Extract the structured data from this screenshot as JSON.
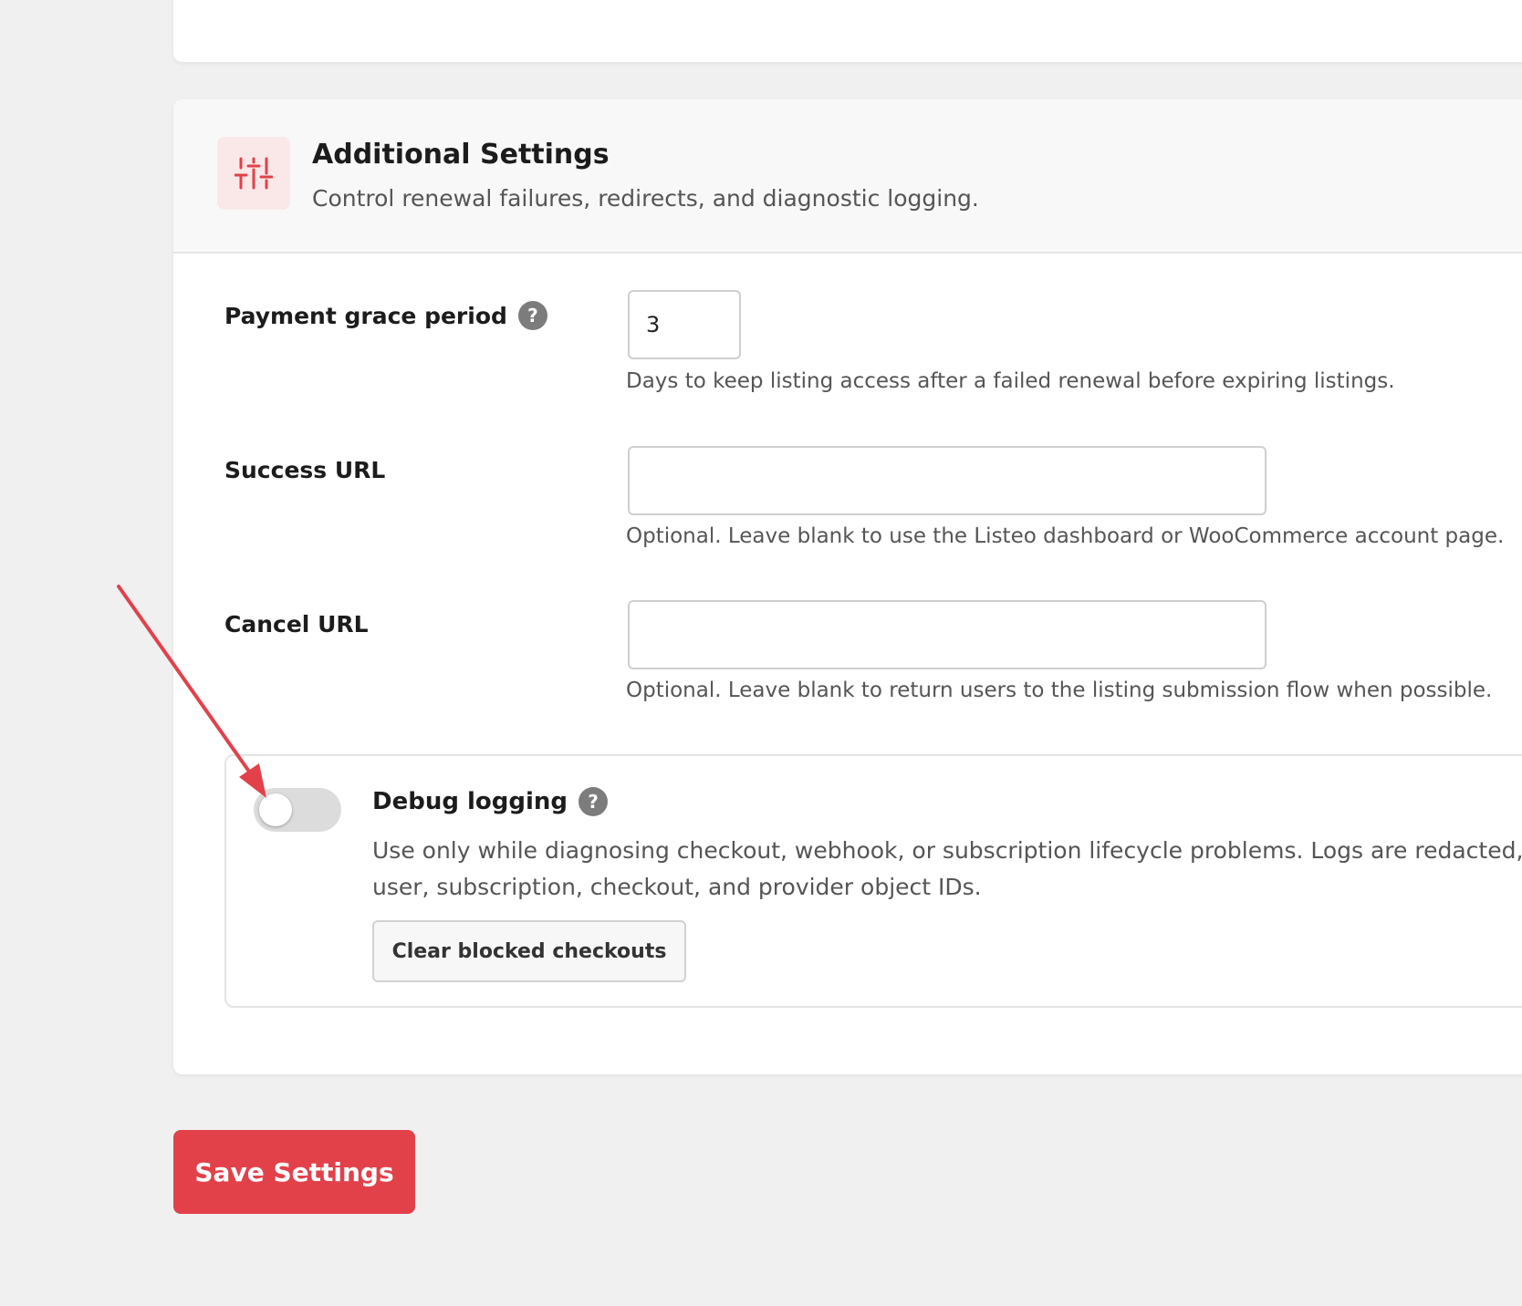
{
  "section": {
    "title": "Additional Settings",
    "subtitle": "Control renewal failures, redirects, and diagnostic logging.",
    "icon": "sliders-icon",
    "accent_color": "#e2414a"
  },
  "fields": {
    "grace_period": {
      "label": "Payment grace period",
      "value": "3",
      "help": "Days to keep listing access after a failed renewal before expiring listings."
    },
    "success_url": {
      "label": "Success URL",
      "value": "",
      "help": "Optional. Leave blank to use the Listeo dashboard or WooCommerce account page."
    },
    "cancel_url": {
      "label": "Cancel URL",
      "value": "",
      "help": "Optional. Leave blank to return users to the listing submission flow when possible."
    }
  },
  "debug": {
    "title": "Debug logging",
    "enabled": false,
    "description_line1": "Use only while diagnosing checkout, webhook, or subscription lifecycle problems. Logs are redacted, bu",
    "description_line2": "user, subscription, checkout, and provider object IDs.",
    "clear_button_label": "Clear blocked checkouts"
  },
  "help_glyph": "?",
  "save_button_label": "Save Settings"
}
